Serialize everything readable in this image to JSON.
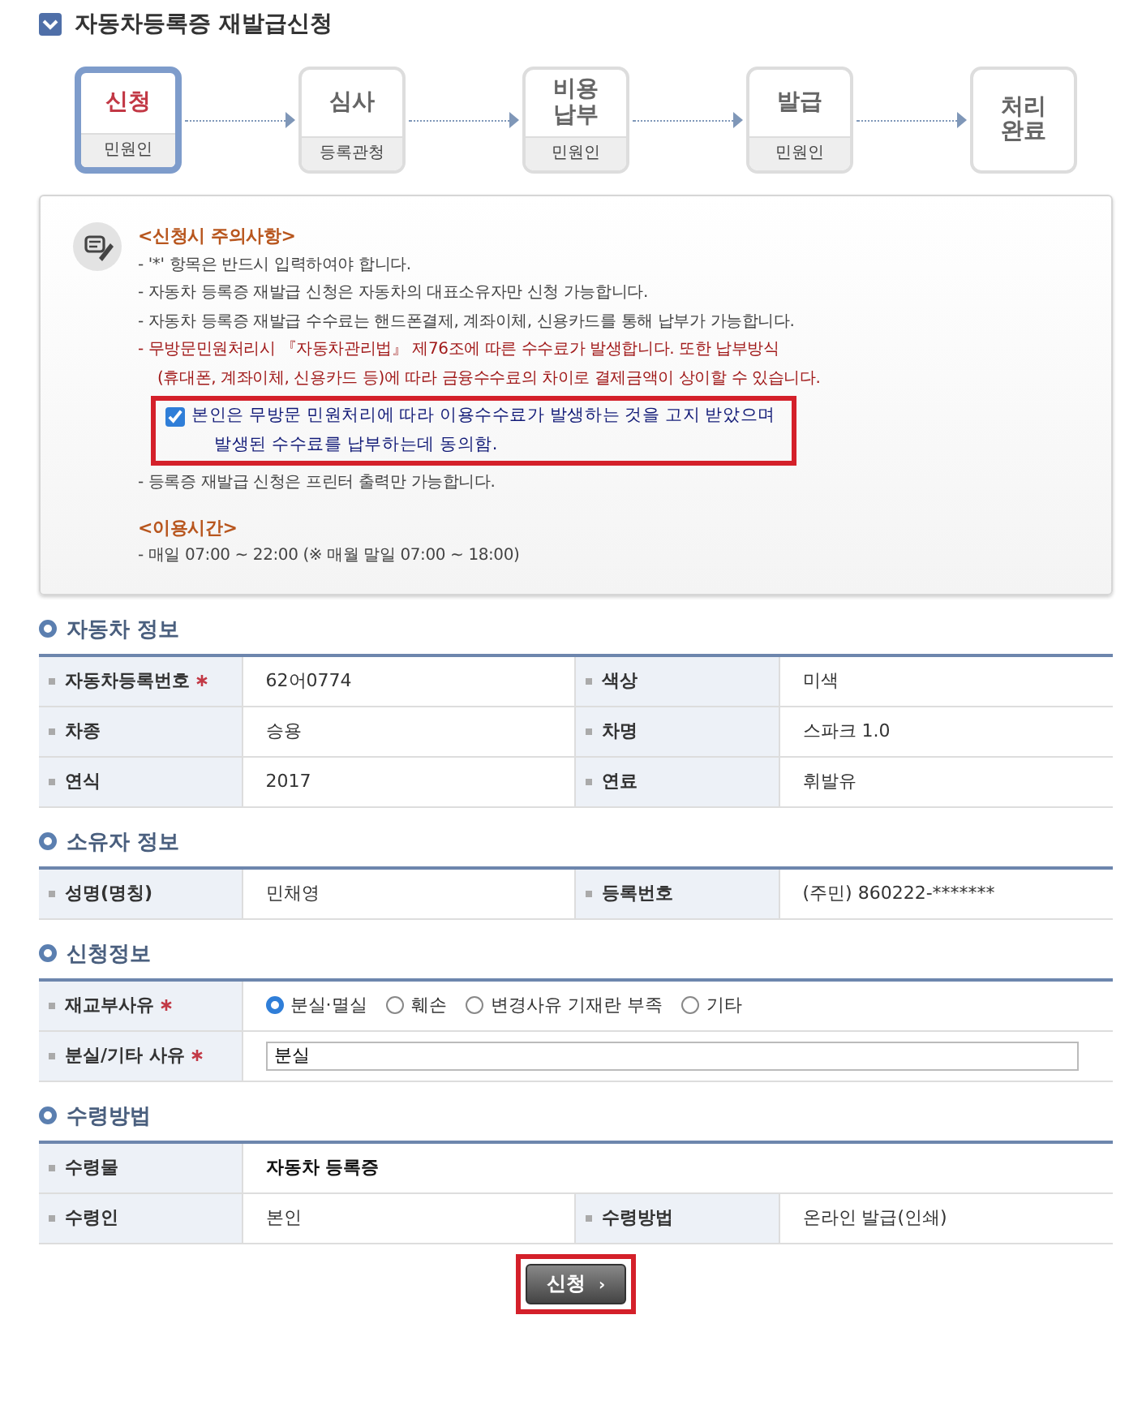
{
  "page_title": "자동차등록증 재발급신청",
  "steps": [
    {
      "label": "신청",
      "role": "민원인",
      "selected": true
    },
    {
      "label": "심사",
      "role": "등록관청",
      "selected": false
    },
    {
      "label": "비용 납부",
      "role": "민원인",
      "selected": false
    },
    {
      "label": "발급",
      "role": "민원인",
      "selected": false
    },
    {
      "label": "처리 완료",
      "selected": false
    }
  ],
  "notice": {
    "heading": "<신청시 주의사항>",
    "items": [
      {
        "kind": "plain",
        "text": "- '*' 항목은 반드시 입력하여야 합니다."
      },
      {
        "kind": "plain",
        "text": "- 자동차 등록증 재발급 신청은 자동차의 대표소유자만 신청 가능합니다."
      },
      {
        "kind": "plain",
        "text": "- 자동차 등록증 재발급 수수료는 핸드폰결제, 계좌이체, 신용카드를 통해 납부가 가능합니다."
      },
      {
        "kind": "warning",
        "lines": [
          "- 무방문민원처리시 『자동차관리법』 제76조에 따른 수수료가 발생합니다. 또한 납부방식",
          "(휴대폰, 계좌이체, 신용카드 등)에 따라 금융수수료의 차이로 결제금액이 상이할 수 있습니다."
        ]
      },
      {
        "kind": "consent",
        "lines": [
          "본인은 무방문 민원처리에 따라 이용수수료가 발생하는 것을 고지 받았으며",
          "발생된 수수료를 납부하는데 동의함."
        ],
        "checked": true,
        "highlighted": true
      },
      {
        "kind": "plain",
        "text": "- 등록증 재발급 신청은 프린터 출력만 가능합니다."
      }
    ],
    "hours_heading": "<이용시간>",
    "hours": "- 매일 07:00 ~ 22:00 (※ 매월 말일 07:00 ~ 18:00)"
  },
  "sections": [
    {
      "title": "자동차 정보",
      "rows": [
        {
          "cells": [
            {
              "kind": "label",
              "text": "자동차등록번호",
              "required": true
            },
            {
              "kind": "value",
              "text": "62어0774"
            },
            {
              "kind": "label",
              "text": "색상",
              "required": false
            },
            {
              "kind": "value",
              "text": "미색"
            }
          ]
        },
        {
          "cells": [
            {
              "kind": "label",
              "text": "차종",
              "required": false
            },
            {
              "kind": "value",
              "text": "승용"
            },
            {
              "kind": "label",
              "text": "차명",
              "required": false
            },
            {
              "kind": "value",
              "text": "스파크 1.0"
            }
          ]
        },
        {
          "cells": [
            {
              "kind": "label",
              "text": "연식",
              "required": false
            },
            {
              "kind": "value",
              "text": "2017"
            },
            {
              "kind": "label",
              "text": "연료",
              "required": false
            },
            {
              "kind": "value",
              "text": "휘발유"
            }
          ]
        }
      ]
    },
    {
      "title": "소유자 정보",
      "rows": [
        {
          "cells": [
            {
              "kind": "label",
              "text": "성명(명칭)",
              "required": false
            },
            {
              "kind": "value",
              "text": "민채영"
            },
            {
              "kind": "label",
              "text": "등록번호",
              "required": false
            },
            {
              "kind": "value",
              "text": "(주민) 860222-*******"
            }
          ]
        }
      ]
    },
    {
      "title": "신청정보",
      "rows": [
        {
          "cells": [
            {
              "kind": "label",
              "text": "재교부사유",
              "required": true
            },
            {
              "kind": "radios",
              "options": [
                {
                  "label": "분실·멸실",
                  "selected": true
                },
                {
                  "label": "훼손",
                  "selected": false
                },
                {
                  "label": "변경사유 기재란 부족",
                  "selected": false
                },
                {
                  "label": "기타",
                  "selected": false
                }
              ]
            }
          ]
        },
        {
          "cells": [
            {
              "kind": "label",
              "text": "분실/기타 사유",
              "required": true
            },
            {
              "kind": "input",
              "value": "분실"
            }
          ]
        }
      ]
    },
    {
      "title": "수령방법",
      "rows": [
        {
          "cells": [
            {
              "kind": "label",
              "text": "수령물",
              "required": false
            },
            {
              "kind": "value",
              "text": "자동차 등록증",
              "bold": true
            }
          ]
        },
        {
          "cells": [
            {
              "kind": "label",
              "text": "수령인",
              "required": false
            },
            {
              "kind": "value",
              "text": "본인"
            },
            {
              "kind": "label",
              "text": "수령방법",
              "required": false
            },
            {
              "kind": "value",
              "text": "온라인 발급(인쇄)"
            }
          ]
        }
      ]
    }
  ],
  "submit": {
    "label": "신청",
    "icon": "›",
    "highlighted": true
  }
}
